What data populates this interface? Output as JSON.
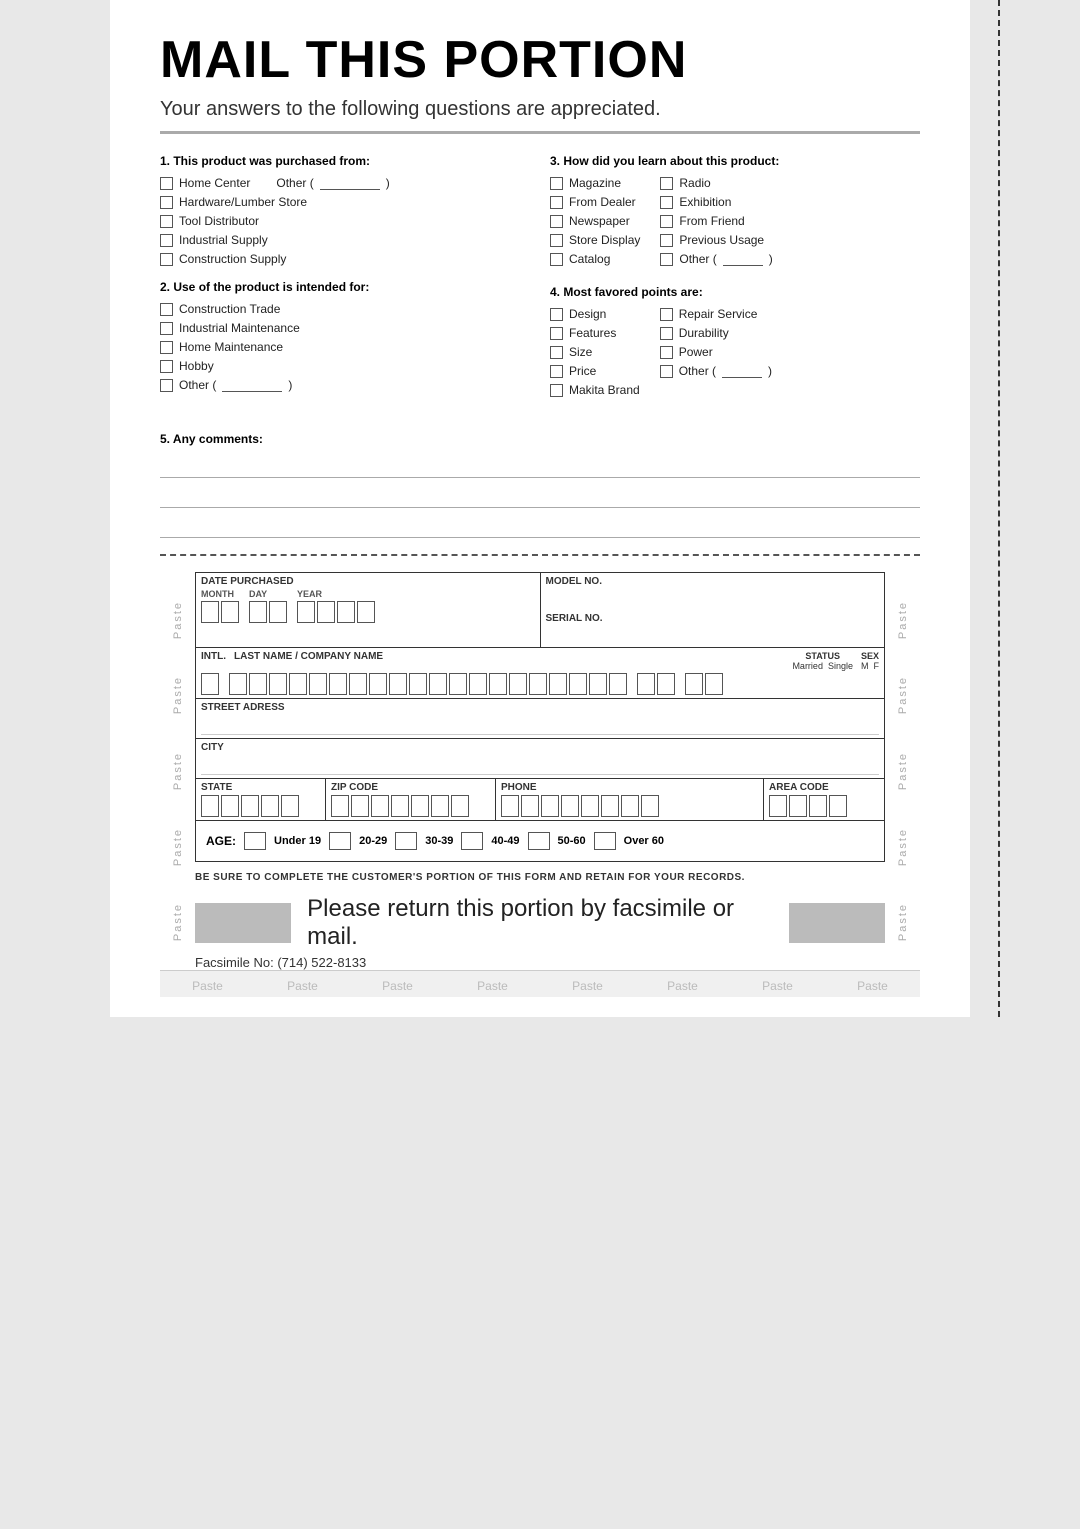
{
  "page": {
    "title": "MAIL THIS PORTION",
    "subtitle": "Your answers to the following questions are appreciated.",
    "q1": {
      "label": "1. This product was purchased from:",
      "options": [
        "Home Center",
        "Hardware/Lumber Store",
        "Tool Distributor",
        "Industrial Supply",
        "Construction Supply"
      ],
      "other_label": "Other (",
      "other_close": ")"
    },
    "q2": {
      "label": "2. Use of the product is intended for:",
      "options": [
        "Construction Trade",
        "Industrial Maintenance",
        "Home Maintenance",
        "Hobby"
      ],
      "other_label": "Other (",
      "other_close": ")"
    },
    "q3": {
      "label": "3. How did you learn about this product:",
      "options_col1": [
        "Magazine",
        "From Dealer",
        "Newspaper",
        "Store Display",
        "Catalog"
      ],
      "options_col2": [
        "Radio",
        "Exhibition",
        "From Friend",
        "Previous Usage"
      ],
      "other_label": "Other (",
      "other_close": ")"
    },
    "q4": {
      "label": "4. Most favored points are:",
      "options_col1": [
        "Design",
        "Features",
        "Size",
        "Price",
        "Makita Brand"
      ],
      "options_col2": [
        "Repair Service",
        "Durability",
        "Power"
      ],
      "other_label": "Other (",
      "other_close": ")"
    },
    "q5": {
      "label": "5. Any comments:"
    },
    "form": {
      "date_purchased": "DATE PURCHASED",
      "month": "MONTH",
      "day": "DAY",
      "year": "YEAR",
      "model_no": "MODEL NO.",
      "serial_no": "SERIAL NO.",
      "intl": "INTL.",
      "last_name": "LAST NAME / COMPANY NAME",
      "status": "STATUS",
      "married": "Married",
      "single": "Single",
      "sex": "SEX",
      "m": "M",
      "f": "F",
      "street": "STREET ADRESS",
      "city": "CITY",
      "state": "STATE",
      "zip": "ZIP CODE",
      "phone": "PHONE",
      "area_code": "AREA CODE",
      "age_label": "AGE:",
      "age_options": [
        "Under 19",
        "20-29",
        "30-39",
        "40-49",
        "50-60",
        "Over 60"
      ]
    },
    "retain_text": "BE SURE TO COMPLETE THE CUSTOMER'S PORTION OF THIS FORM AND RETAIN FOR YOUR RECORDS.",
    "return_text": "Please return this portion by facsimile or mail.",
    "fax_text": "Facsimile No: (714) 522-8133",
    "paste_labels": [
      "Paste",
      "Paste",
      "Paste",
      "Paste",
      "Paste",
      "Paste",
      "Paste",
      "Paste"
    ],
    "side_paste": "Paste"
  }
}
